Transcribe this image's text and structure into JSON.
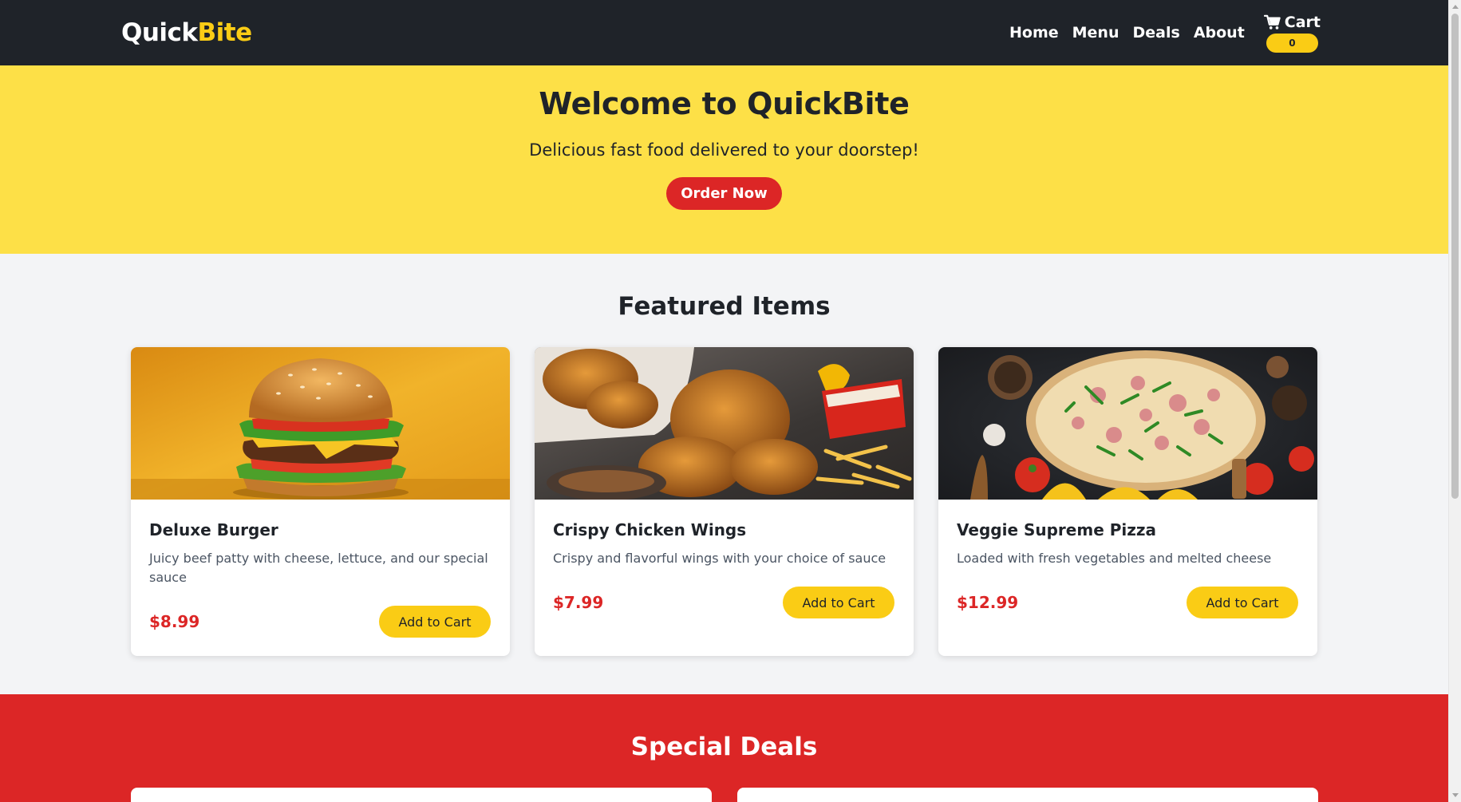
{
  "header": {
    "logo_part1": "Quick",
    "logo_part2": "Bite",
    "nav": [
      "Home",
      "Menu",
      "Deals",
      "About"
    ],
    "cart_label": "Cart",
    "cart_count": "0"
  },
  "hero": {
    "title": "Welcome to QuickBite",
    "subtitle": "Delicious fast food delivered to your doorstep!",
    "cta": "Order Now"
  },
  "featured": {
    "heading": "Featured Items",
    "items": [
      {
        "name": "Deluxe Burger",
        "description": "Juicy beef patty with cheese, lettuce, and our special sauce",
        "price": "$8.99",
        "button": "Add to Cart",
        "image": "burger-image"
      },
      {
        "name": "Crispy Chicken Wings",
        "description": "Crispy and flavorful wings with your choice of sauce",
        "price": "$7.99",
        "button": "Add to Cart",
        "image": "chicken-wings-image"
      },
      {
        "name": "Veggie Supreme Pizza",
        "description": "Loaded with fresh vegetables and melted cheese",
        "price": "$12.99",
        "button": "Add to Cart",
        "image": "pizza-image"
      }
    ]
  },
  "deals": {
    "heading": "Special Deals"
  },
  "colors": {
    "header_bg": "#1f2329",
    "accent_yellow": "#facc15",
    "hero_bg": "#fde047",
    "accent_red": "#dc2626"
  }
}
